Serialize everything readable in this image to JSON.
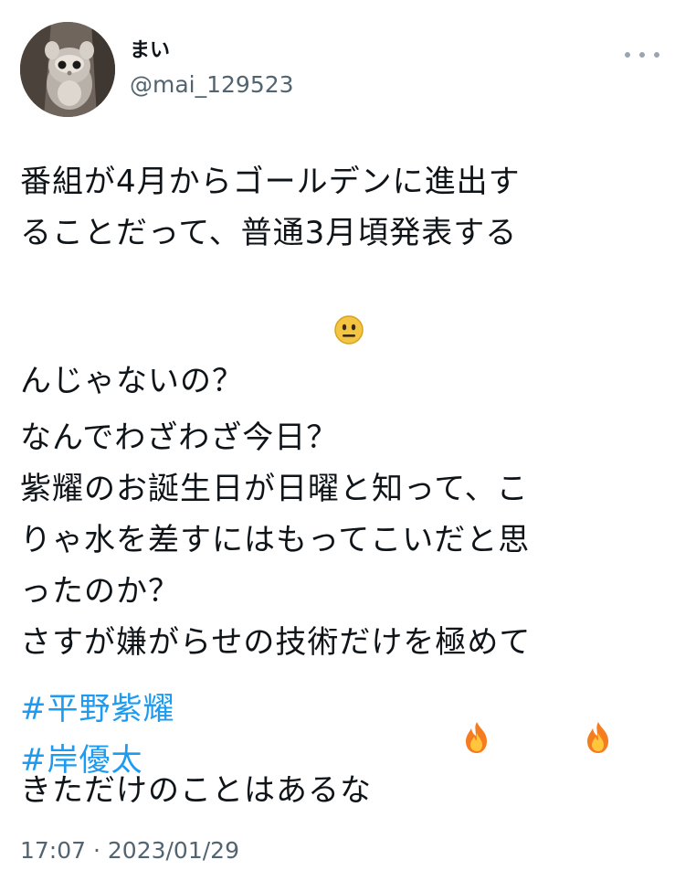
{
  "user": {
    "display_name": "まい",
    "handle": "@mai_129523"
  },
  "tweet": {
    "lines": [
      "番組が4月からゴールデンに進出す",
      "ることだって、普通3月頃発表する",
      "んじゃないの？",
      "なんでわざわざ今日？",
      "紫耀のお誕生日が日曜と知って、こ",
      "りゃ水を差すにはもってこいだと思",
      "ったのか？",
      "さすが嫌がらせの技術だけを極めて",
      "きただけのことはあるな"
    ],
    "emoji_neutral": "neutral-face-icon",
    "emoji_fire": "fire-icon",
    "hashtags": [
      "#平野紫耀",
      "#岸優太"
    ],
    "timestamp": "17:07 · 2023/01/29"
  },
  "colors": {
    "text": "#0f1419",
    "secondary": "#536471",
    "link": "#1d9bf0"
  }
}
